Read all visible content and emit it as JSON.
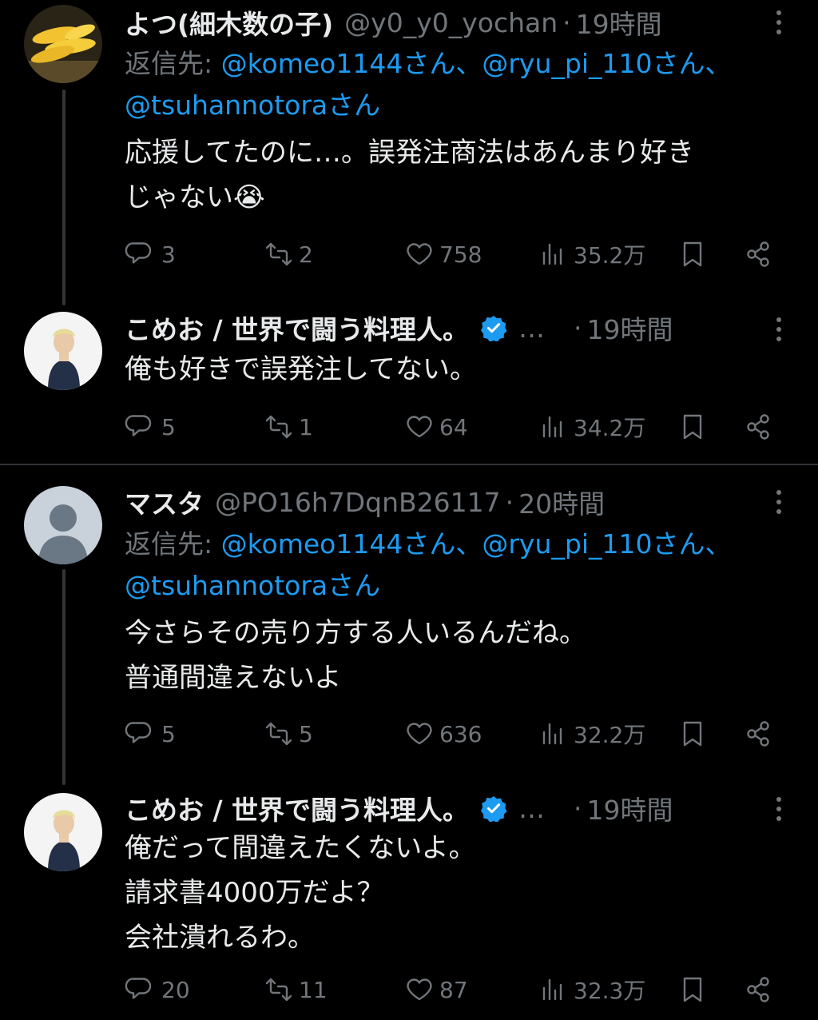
{
  "tweets": [
    {
      "name": "よつ(細木数の子)",
      "handle": "@y0_y0_yochan",
      "time": "19時間",
      "reply_prefix": "返信先: ",
      "mentions_line1": "@komeo1144さん、@ryu_pi_110さん、",
      "mentions_line2": "@tsuhannotoraさん",
      "text_lines": [
        "応援してたのに…。誤発注商法はあんまり好き",
        "じゃない😭"
      ],
      "replies": "3",
      "retweets": "2",
      "likes": "758",
      "views": "35.2万"
    },
    {
      "name": "こめお / 世界で闘う料理人。",
      "ellipsis": "…",
      "time": "19時間",
      "text_lines": [
        "俺も好きで誤発注してない。"
      ],
      "replies": "5",
      "retweets": "1",
      "likes": "64",
      "views": "34.2万"
    },
    {
      "name": "マスタ",
      "handle": "@PO16h7DqnB26117",
      "time": "20時間",
      "reply_prefix": "返信先: ",
      "mentions_line1": "@komeo1144さん、@ryu_pi_110さん、",
      "mentions_line2": "@tsuhannotoraさん",
      "text_lines": [
        "今さらその売り方する人いるんだね。",
        "普通間違えないよ"
      ],
      "replies": "5",
      "retweets": "5",
      "likes": "636",
      "views": "32.2万"
    },
    {
      "name": "こめお / 世界で闘う料理人。",
      "ellipsis": "…",
      "time": "19時間",
      "text_lines": [
        "俺だって間違えたくないよ。",
        "請求書4000万だよ？",
        "会社潰れるわ。"
      ],
      "replies": "20",
      "retweets": "11",
      "likes": "87",
      "views": "32.3万"
    }
  ],
  "separator": "·",
  "icons": {
    "reply": "reply-icon",
    "retweet": "retweet-icon",
    "like": "heart-icon",
    "views": "views-icon",
    "bookmark": "bookmark-icon",
    "share": "share-icon",
    "verified": "verified-badge-icon",
    "more": "more-options-icon"
  },
  "colors": {
    "background": "#000000",
    "text": "#e7e9ea",
    "muted": "#71767b",
    "link": "#1d9bf0",
    "verified": "#1d9bf0"
  }
}
